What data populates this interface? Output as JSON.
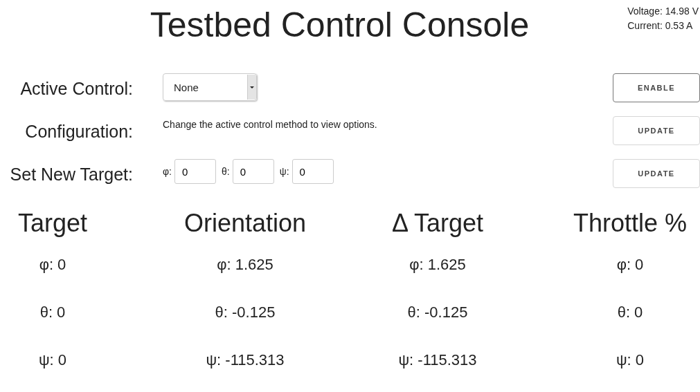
{
  "title": "Testbed Control Console",
  "status": [
    "Voltage: 14.98 V",
    "Current: 0.53 A"
  ],
  "active_control": {
    "label": "Active Control:",
    "value": "None",
    "button": {
      "label": "ENABLE",
      "disabled": false
    }
  },
  "configuration": {
    "label": "Configuration:",
    "text": "Change the active control method to view options.",
    "button": {
      "label": "UPDATE",
      "disabled": true
    }
  },
  "set_new_target": {
    "label": "Set New Target:",
    "fields": [
      {
        "label": "φ:",
        "value": "0"
      },
      {
        "label": "θ:",
        "value": "0"
      },
      {
        "label": "ψ:",
        "value": "0"
      }
    ],
    "button": {
      "label": "UPDATE",
      "disabled": true
    }
  },
  "columns": [
    {
      "heading": "Target",
      "values": [
        "φ: 0",
        "θ: 0",
        "ψ: 0"
      ]
    },
    {
      "heading": "Orientation",
      "values": [
        "φ: 1.625",
        "θ: -0.125",
        "ψ: -115.313"
      ]
    },
    {
      "heading": "Δ Target",
      "values": [
        "φ: 1.625",
        "θ: -0.125",
        "ψ: -115.313"
      ]
    },
    {
      "heading": "Throttle %",
      "values": [
        "φ: 0",
        "θ: 0",
        "ψ: 0"
      ]
    }
  ]
}
